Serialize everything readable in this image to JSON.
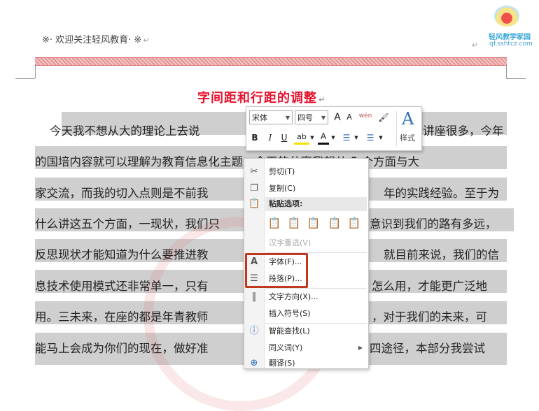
{
  "header": {
    "text": "※· 欢迎关注轻风教育· ※",
    "para_mark": "↵",
    "right_mark": "↵"
  },
  "logo": {
    "name": "轻风教学家园",
    "url": "qf.sshtcz.com"
  },
  "document": {
    "title": "字间距和行距的调整",
    "title_mark": "↵",
    "lines": [
      "    今天我不想从大的理论上去说",
      "的国培内容就可以理解为教育信息化主题，今天的分享我想从 5 个方面与大",
      "家交流，而我的切入点则是不前我",
      "什么讲这五个方面，一现状，我们只",
      "反思现状才能知道为什么要推进教",
      "息技术使用模式还非常单一，只有",
      "用。三未来，在座的都是年青教师",
      "能马上会成为你们的现在，做好准"
    ],
    "lines_right": [
      "讲座很多，今年",
      "",
      "年的实践经验。至于为",
      "意识到我们的路有多远，",
      "就目前来说，我们的信",
      "怎么用，才能更广泛地",
      "，对于我们的未来，可",
      "四途径，本部分我尝试"
    ]
  },
  "mini_toolbar": {
    "font_name": "宋体",
    "font_size": "四号",
    "grow_font": "A",
    "shrink_font": "A",
    "phonetic": "wén",
    "format_painter": "🖌",
    "bold": "B",
    "italic": "I",
    "underline": "U",
    "highlight": "ab",
    "font_color": "A",
    "bullets": "☰",
    "numbering": "☰",
    "styles_label": "样式",
    "styles_glyph": "A"
  },
  "context_menu": {
    "items": [
      {
        "icon": "scissors-icon",
        "glyph": "✂",
        "label": "剪切(T)",
        "disabled": false
      },
      {
        "icon": "copy-icon",
        "glyph": "❐",
        "label": "复制(C)",
        "disabled": false
      }
    ],
    "paste_header": "粘贴选项:",
    "paste_options": [
      "keep-source-icon",
      "merge-format-icon",
      "link-icon",
      "picture-icon",
      "text-only-icon"
    ],
    "hanzi": "汉字重选(V)",
    "font": "字体(F)...",
    "paragraph": "段落(P)...",
    "text_direction": "文字方向(X)...",
    "insert_symbol": "插入符号(S)",
    "smart_lookup": "智能查找(L)",
    "synonyms": "同义词(Y)",
    "translate": "翻译(S)"
  },
  "colors": {
    "title_red": "#e8112d",
    "highlight": "#cfcfcf",
    "callout_box": "#c0391f",
    "style_blue": "#2e6fb7"
  }
}
